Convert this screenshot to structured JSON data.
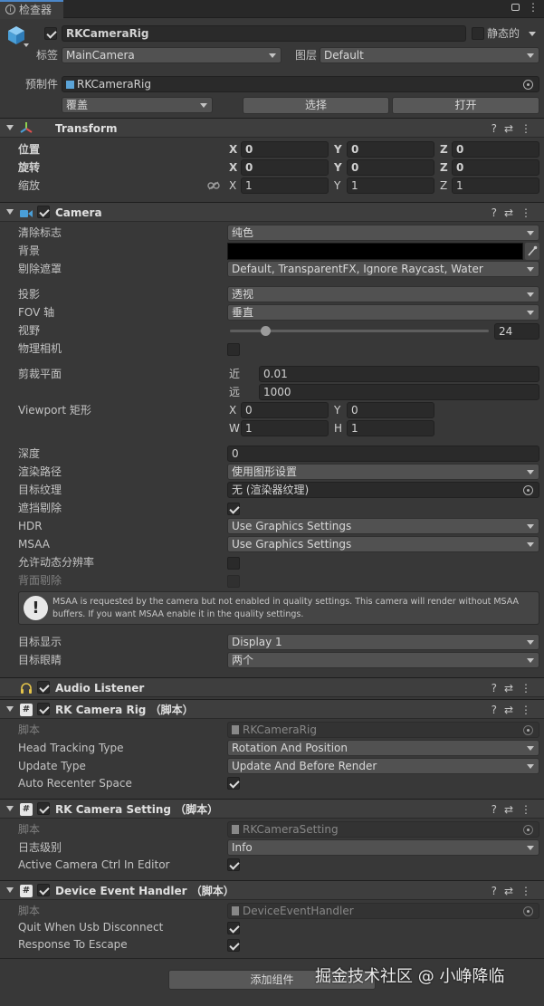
{
  "window": {
    "tab_title": "检查器"
  },
  "object": {
    "name": "RKCameraRig",
    "static_label": "静态的",
    "tag_label": "标签",
    "tag_value": "MainCamera",
    "layer_label": "图层",
    "layer_value": "Default",
    "prefab_label": "预制件",
    "prefab_value": "RKCameraRig",
    "overrides_value": "覆盖",
    "select_button": "选择",
    "open_button": "打开"
  },
  "transform": {
    "title": "Transform",
    "position_label": "位置",
    "rotation_label": "旋转",
    "scale_label": "缩放",
    "axis_x": "X",
    "axis_y": "Y",
    "axis_z": "Z",
    "position": {
      "x": "0",
      "y": "0",
      "z": "0"
    },
    "rotation": {
      "x": "0",
      "y": "0",
      "z": "0"
    },
    "scale": {
      "x": "1",
      "y": "1",
      "z": "1"
    }
  },
  "camera": {
    "title": "Camera",
    "clear_flags_label": "清除标志",
    "clear_flags_value": "纯色",
    "background_label": "背景",
    "background_color": "#000000",
    "culling_mask_label": "剔除遮罩",
    "culling_mask_value": "Default, TransparentFX, Ignore Raycast, Water",
    "projection_label": "投影",
    "projection_value": "透视",
    "fov_axis_label": "FOV 轴",
    "fov_axis_value": "垂直",
    "fov_label": "视野",
    "fov_value": "24",
    "physical_camera_label": "物理相机",
    "clipping_label": "剪裁平面",
    "near_label": "近",
    "near_value": "0.01",
    "far_label": "远",
    "far_value": "1000",
    "viewport_label": "Viewport 矩形",
    "vp_x_label": "X",
    "vp_y_label": "Y",
    "vp_w_label": "W",
    "vp_h_label": "H",
    "vp_x": "0",
    "vp_y": "0",
    "vp_w": "1",
    "vp_h": "1",
    "depth_label": "深度",
    "depth_value": "0",
    "render_path_label": "渲染路径",
    "render_path_value": "使用图形设置",
    "target_texture_label": "目标纹理",
    "target_texture_value": "无 (渲染器纹理)",
    "occlusion_label": "遮挡剔除",
    "hdr_label": "HDR",
    "hdr_value": "Use Graphics Settings",
    "msaa_label": "MSAA",
    "msaa_value": "Use Graphics Settings",
    "dynamic_res_label": "允许动态分辨率",
    "backface_label": "背面剔除",
    "warning_text": "MSAA is requested by the camera but not enabled in quality settings. This camera will render without MSAA buffers. If you want MSAA enable it in the quality settings.",
    "target_display_label": "目标显示",
    "target_display_value": "Display 1",
    "target_eye_label": "目标眼睛",
    "target_eye_value": "两个"
  },
  "audio_listener": {
    "title": "Audio Listener"
  },
  "rk_camera_rig": {
    "title": "RK Camera Rig （脚本）",
    "script_label": "脚本",
    "script_value": "RKCameraRig",
    "head_tracking_label": "Head Tracking Type",
    "head_tracking_value": "Rotation And Position",
    "update_type_label": "Update Type",
    "update_type_value": "Update And Before Render",
    "auto_recenter_label": "Auto Recenter Space"
  },
  "rk_camera_setting": {
    "title": "RK Camera Setting （脚本）",
    "script_label": "脚本",
    "script_value": "RKCameraSetting",
    "log_level_label": "日志级别",
    "log_level_value": "Info",
    "active_ctrl_label": "Active Camera Ctrl In Editor"
  },
  "device_event_handler": {
    "title": "Device Event Handler （脚本）",
    "script_label": "脚本",
    "script_value": "DeviceEventHandler",
    "quit_label": "Quit When Usb Disconnect",
    "escape_label": "Response To Escape"
  },
  "footer": {
    "add_component_button": "添加组件",
    "watermark": "掘金技术社区 @ 小峥降临"
  }
}
